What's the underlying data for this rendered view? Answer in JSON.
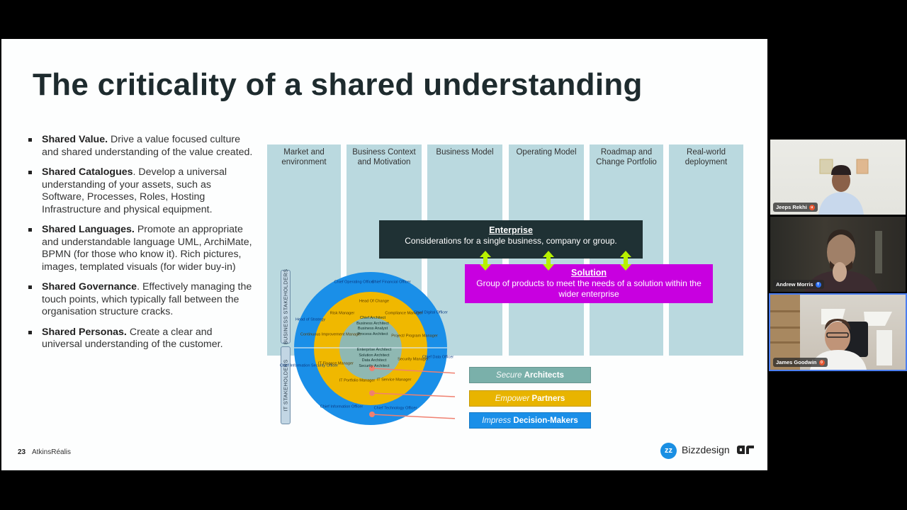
{
  "slide": {
    "title": "The criticality of a shared understanding",
    "bullets": [
      {
        "bold": "Shared Value.",
        "text": " Drive a value focused culture and shared understanding of the value created."
      },
      {
        "bold": "Shared Catalogues",
        "text": ". Develop a universal understanding of your assets, such as Software, Processes, Roles, Hosting Infrastructure and physical equipment."
      },
      {
        "bold": "Shared Languages.",
        "text": " Promote an appropriate and understandable language UML, ArchiMate, BPMN (for those who know it). Rich pictures, images, templated visuals (for wider buy-in)"
      },
      {
        "bold": "Shared Governance",
        "text": ". Effectively managing the touch points, which typically fall between the organisation structure cracks."
      },
      {
        "bold": "Shared Personas.",
        "text": " Create a clear and universal understanding of the customer."
      }
    ],
    "columns": [
      "Market and environment",
      "Business Context and Motivation",
      "Business Model",
      "Operating Model",
      "Roadmap and Change Portfolio",
      "Real-world deployment"
    ],
    "enterprise": {
      "heading": "Enterprise",
      "text": "Considerations for a single business, company or group.",
      "color": "#1f3134"
    },
    "solution": {
      "heading": "Solution",
      "text": "Group of products to meet the needs of a solution within the wider enterprise",
      "color": "#c800e0"
    },
    "arrow_color": "#b6f000",
    "stakeholders": {
      "business_label": "BUSINESS STAKEHOLDERS",
      "it_label": "IT STAKEHOLDERS",
      "outer_ring": [
        "Chief Operating Officer",
        "Chief Financial Officer",
        "Chief Digital Officer",
        "Head of Strategy",
        "Chief Data Officer",
        "Chief Information Security Officer",
        "Chief Information Officer",
        "Chief Technology Officer"
      ],
      "middle_ring": [
        "Head Of Change",
        "Risk Manager",
        "Compliance Manager",
        "Continuous Improvement Manager",
        "Project/ Program Manager",
        "IT Finance Manager",
        "Security Manager",
        "IT Portfolio Manager",
        "IT Service Manager"
      ],
      "inner_business": [
        "Chief Architect",
        "Business Architect",
        "Business Analyst",
        "Process Architect"
      ],
      "inner_it": [
        "Enterprise Architect",
        "Solution Architect",
        "Data Architect",
        "Security Architect"
      ],
      "colors": {
        "outer": "#1a8fe8",
        "middle": "#f0b800",
        "inner": "#8fb8b2",
        "connector": "#f08070"
      }
    },
    "tags": [
      {
        "verb": "Secure",
        "noun": "Architects",
        "color": "#7ab0aa"
      },
      {
        "verb": "Empower",
        "noun": "Partners",
        "color": "#e8b400"
      },
      {
        "verb": "Impress",
        "noun": "Decision-Makers",
        "color": "#1a8fe8"
      }
    ],
    "footer": {
      "page_number": "23",
      "brand": "AtkinsRéalis",
      "partner": "Bizzdesign",
      "partner_logo_text": "zz"
    }
  },
  "participants": [
    {
      "name": "Jeeps Rekhi",
      "badge": "u",
      "badge_color": "#e8552f"
    },
    {
      "name": "Andrew Morris",
      "badge": "T",
      "badge_color": "#2b6ff0"
    },
    {
      "name": "James Goodwin",
      "badge": "0",
      "badge_color": "#e8552f",
      "active": true
    }
  ]
}
